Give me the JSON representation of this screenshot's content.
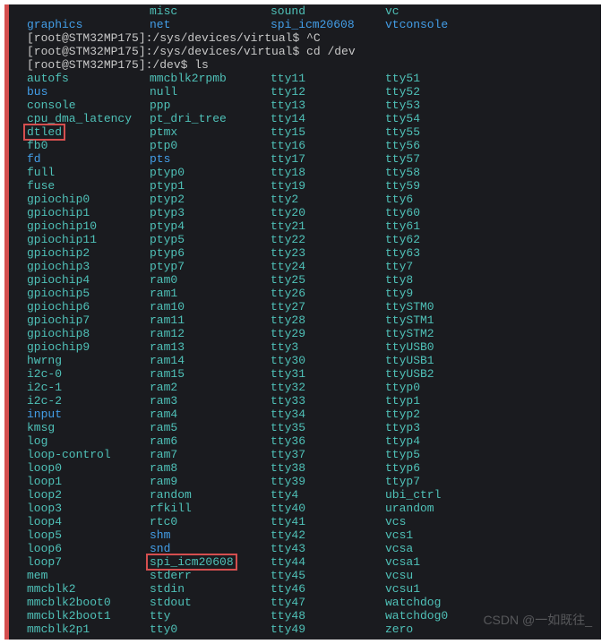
{
  "top_dirs": [
    {
      "c1": "",
      "cls1": "teal",
      "c2": "misc",
      "cls2": "teal",
      "c3": "sound",
      "cls3": "teal",
      "c4": "vc",
      "cls4": "teal"
    },
    {
      "c1": "graphics",
      "cls1": "blue",
      "c2": "net",
      "cls2": "blue",
      "c3": "spi_icm20608",
      "cls3": "blue",
      "c4": "vtconsole",
      "cls4": "blue"
    }
  ],
  "prompts": [
    "[root@STM32MP175]:/sys/devices/virtual$ ^C",
    "[root@STM32MP175]:/sys/devices/virtual$ cd /dev",
    "[root@STM32MP175]:/dev$ ls"
  ],
  "listing": [
    {
      "c1": "autofs",
      "cls1": "teal",
      "c2": "mmcblk2rpmb",
      "cls2": "teal",
      "c3": "tty11",
      "cls3": "teal",
      "c4": "tty51",
      "cls4": "teal"
    },
    {
      "c1": "bus",
      "cls1": "blue",
      "c2": "null",
      "cls2": "teal",
      "c3": "tty12",
      "cls3": "teal",
      "c4": "tty52",
      "cls4": "teal"
    },
    {
      "c1": "console",
      "cls1": "teal",
      "c2": "ppp",
      "cls2": "teal",
      "c3": "tty13",
      "cls3": "teal",
      "c4": "tty53",
      "cls4": "teal"
    },
    {
      "c1": "cpu_dma_latency",
      "cls1": "teal",
      "c2": "pt_dri_tree",
      "cls2": "teal",
      "c3": "tty14",
      "cls3": "teal",
      "c4": "tty54",
      "cls4": "teal"
    },
    {
      "c1": "dtled",
      "cls1": "teal",
      "box1": true,
      "c2": "ptmx",
      "cls2": "teal",
      "c3": "tty15",
      "cls3": "teal",
      "c4": "tty55",
      "cls4": "teal"
    },
    {
      "c1": "fb0",
      "cls1": "teal",
      "c2": "ptp0",
      "cls2": "teal",
      "c3": "tty16",
      "cls3": "teal",
      "c4": "tty56",
      "cls4": "teal"
    },
    {
      "c1": "fd",
      "cls1": "blue",
      "c2": "pts",
      "cls2": "blue",
      "c3": "tty17",
      "cls3": "teal",
      "c4": "tty57",
      "cls4": "teal"
    },
    {
      "c1": "full",
      "cls1": "teal",
      "c2": "ptyp0",
      "cls2": "teal",
      "c3": "tty18",
      "cls3": "teal",
      "c4": "tty58",
      "cls4": "teal"
    },
    {
      "c1": "fuse",
      "cls1": "teal",
      "c2": "ptyp1",
      "cls2": "teal",
      "c3": "tty19",
      "cls3": "teal",
      "c4": "tty59",
      "cls4": "teal"
    },
    {
      "c1": "gpiochip0",
      "cls1": "teal",
      "c2": "ptyp2",
      "cls2": "teal",
      "c3": "tty2",
      "cls3": "teal",
      "c4": "tty6",
      "cls4": "teal"
    },
    {
      "c1": "gpiochip1",
      "cls1": "teal",
      "c2": "ptyp3",
      "cls2": "teal",
      "c3": "tty20",
      "cls3": "teal",
      "c4": "tty60",
      "cls4": "teal"
    },
    {
      "c1": "gpiochip10",
      "cls1": "teal",
      "c2": "ptyp4",
      "cls2": "teal",
      "c3": "tty21",
      "cls3": "teal",
      "c4": "tty61",
      "cls4": "teal"
    },
    {
      "c1": "gpiochip11",
      "cls1": "teal",
      "c2": "ptyp5",
      "cls2": "teal",
      "c3": "tty22",
      "cls3": "teal",
      "c4": "tty62",
      "cls4": "teal"
    },
    {
      "c1": "gpiochip2",
      "cls1": "teal",
      "c2": "ptyp6",
      "cls2": "teal",
      "c3": "tty23",
      "cls3": "teal",
      "c4": "tty63",
      "cls4": "teal"
    },
    {
      "c1": "gpiochip3",
      "cls1": "teal",
      "c2": "ptyp7",
      "cls2": "teal",
      "c3": "tty24",
      "cls3": "teal",
      "c4": "tty7",
      "cls4": "teal"
    },
    {
      "c1": "gpiochip4",
      "cls1": "teal",
      "c2": "ram0",
      "cls2": "teal",
      "c3": "tty25",
      "cls3": "teal",
      "c4": "tty8",
      "cls4": "teal"
    },
    {
      "c1": "gpiochip5",
      "cls1": "teal",
      "c2": "ram1",
      "cls2": "teal",
      "c3": "tty26",
      "cls3": "teal",
      "c4": "tty9",
      "cls4": "teal"
    },
    {
      "c1": "gpiochip6",
      "cls1": "teal",
      "c2": "ram10",
      "cls2": "teal",
      "c3": "tty27",
      "cls3": "teal",
      "c4": "ttySTM0",
      "cls4": "teal"
    },
    {
      "c1": "gpiochip7",
      "cls1": "teal",
      "c2": "ram11",
      "cls2": "teal",
      "c3": "tty28",
      "cls3": "teal",
      "c4": "ttySTM1",
      "cls4": "teal"
    },
    {
      "c1": "gpiochip8",
      "cls1": "teal",
      "c2": "ram12",
      "cls2": "teal",
      "c3": "tty29",
      "cls3": "teal",
      "c4": "ttySTM2",
      "cls4": "teal"
    },
    {
      "c1": "gpiochip9",
      "cls1": "teal",
      "c2": "ram13",
      "cls2": "teal",
      "c3": "tty3",
      "cls3": "teal",
      "c4": "ttyUSB0",
      "cls4": "teal"
    },
    {
      "c1": "hwrng",
      "cls1": "teal",
      "c2": "ram14",
      "cls2": "teal",
      "c3": "tty30",
      "cls3": "teal",
      "c4": "ttyUSB1",
      "cls4": "teal"
    },
    {
      "c1": "i2c-0",
      "cls1": "teal",
      "c2": "ram15",
      "cls2": "teal",
      "c3": "tty31",
      "cls3": "teal",
      "c4": "ttyUSB2",
      "cls4": "teal"
    },
    {
      "c1": "i2c-1",
      "cls1": "teal",
      "c2": "ram2",
      "cls2": "teal",
      "c3": "tty32",
      "cls3": "teal",
      "c4": "ttyp0",
      "cls4": "teal"
    },
    {
      "c1": "i2c-2",
      "cls1": "teal",
      "c2": "ram3",
      "cls2": "teal",
      "c3": "tty33",
      "cls3": "teal",
      "c4": "ttyp1",
      "cls4": "teal"
    },
    {
      "c1": "input",
      "cls1": "blue",
      "c2": "ram4",
      "cls2": "teal",
      "c3": "tty34",
      "cls3": "teal",
      "c4": "ttyp2",
      "cls4": "teal"
    },
    {
      "c1": "kmsg",
      "cls1": "teal",
      "c2": "ram5",
      "cls2": "teal",
      "c3": "tty35",
      "cls3": "teal",
      "c4": "ttyp3",
      "cls4": "teal"
    },
    {
      "c1": "log",
      "cls1": "teal",
      "c2": "ram6",
      "cls2": "teal",
      "c3": "tty36",
      "cls3": "teal",
      "c4": "ttyp4",
      "cls4": "teal"
    },
    {
      "c1": "loop-control",
      "cls1": "teal",
      "c2": "ram7",
      "cls2": "teal",
      "c3": "tty37",
      "cls3": "teal",
      "c4": "ttyp5",
      "cls4": "teal"
    },
    {
      "c1": "loop0",
      "cls1": "teal",
      "c2": "ram8",
      "cls2": "teal",
      "c3": "tty38",
      "cls3": "teal",
      "c4": "ttyp6",
      "cls4": "teal"
    },
    {
      "c1": "loop1",
      "cls1": "teal",
      "c2": "ram9",
      "cls2": "teal",
      "c3": "tty39",
      "cls3": "teal",
      "c4": "ttyp7",
      "cls4": "teal"
    },
    {
      "c1": "loop2",
      "cls1": "teal",
      "c2": "random",
      "cls2": "teal",
      "c3": "tty4",
      "cls3": "teal",
      "c4": "ubi_ctrl",
      "cls4": "teal"
    },
    {
      "c1": "loop3",
      "cls1": "teal",
      "c2": "rfkill",
      "cls2": "teal",
      "c3": "tty40",
      "cls3": "teal",
      "c4": "urandom",
      "cls4": "teal"
    },
    {
      "c1": "loop4",
      "cls1": "teal",
      "c2": "rtc0",
      "cls2": "teal",
      "c3": "tty41",
      "cls3": "teal",
      "c4": "vcs",
      "cls4": "teal"
    },
    {
      "c1": "loop5",
      "cls1": "teal",
      "c2": "shm",
      "cls2": "blue",
      "c3": "tty42",
      "cls3": "teal",
      "c4": "vcs1",
      "cls4": "teal"
    },
    {
      "c1": "loop6",
      "cls1": "teal",
      "c2": "snd",
      "cls2": "blue",
      "c3": "tty43",
      "cls3": "teal",
      "c4": "vcsa",
      "cls4": "teal"
    },
    {
      "c1": "loop7",
      "cls1": "teal",
      "c2": "spi_icm20608",
      "cls2": "teal",
      "box2": true,
      "c3": "tty44",
      "cls3": "teal",
      "c4": "vcsa1",
      "cls4": "teal"
    },
    {
      "c1": "mem",
      "cls1": "teal",
      "c2": "stderr",
      "cls2": "teal",
      "c3": "tty45",
      "cls3": "teal",
      "c4": "vcsu",
      "cls4": "teal"
    },
    {
      "c1": "mmcblk2",
      "cls1": "teal",
      "c2": "stdin",
      "cls2": "teal",
      "c3": "tty46",
      "cls3": "teal",
      "c4": "vcsu1",
      "cls4": "teal"
    },
    {
      "c1": "mmcblk2boot0",
      "cls1": "teal",
      "c2": "stdout",
      "cls2": "teal",
      "c3": "tty47",
      "cls3": "teal",
      "c4": "watchdog",
      "cls4": "teal"
    },
    {
      "c1": "mmcblk2boot1",
      "cls1": "teal",
      "c2": "tty",
      "cls2": "teal",
      "c3": "tty48",
      "cls3": "teal",
      "c4": "watchdog0",
      "cls4": "teal"
    },
    {
      "c1": "mmcblk2p1",
      "cls1": "teal",
      "c2": "tty0",
      "cls2": "teal",
      "c3": "tty49",
      "cls3": "teal",
      "c4": "zero",
      "cls4": "teal"
    }
  ],
  "watermark": "CSDN @一如既往_"
}
